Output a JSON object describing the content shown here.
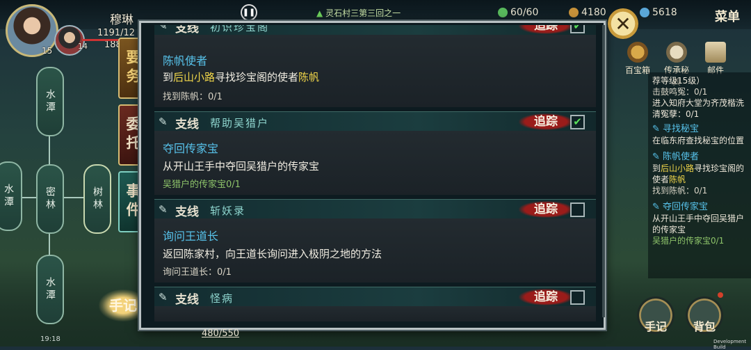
{
  "hud": {
    "player_name": "穆琳",
    "hp": "1191/12",
    "mp": "188",
    "level": "15",
    "pet_level": "14",
    "location": "灵石村三第三回之一",
    "energy": "60/60",
    "copper": "4180",
    "jade": "5618",
    "menu_label": "菜单",
    "time": "19:18",
    "bottom_value": "480/550",
    "dev_build": "Development Build"
  },
  "map_nodes": [
    "水潭",
    "密林",
    "水潭",
    "树林",
    "水潭"
  ],
  "side_tabs": [
    {
      "label": "要务"
    },
    {
      "label": "委托"
    },
    {
      "label": "事件"
    }
  ],
  "shouji_label": "手记",
  "quests": [
    {
      "type": "支线",
      "name": "初识珍宝阁",
      "checked": true,
      "title": "陈帆使者",
      "desc_pre": "到",
      "desc_hl1": "后山小路",
      "desc_mid": "寻找珍宝阁的使者",
      "desc_hl2": "陈帆",
      "progress": "找到陈帆：0/1"
    },
    {
      "type": "支线",
      "name": "帮助吴猎户",
      "checked": true,
      "title": "夺回传家宝",
      "desc": "从开山王手中夺回吴猎户的传家宝",
      "progress": "吴猎户的传家宝0/1"
    },
    {
      "type": "支线",
      "name": "斩妖录",
      "checked": false,
      "title": "询问王道长",
      "desc": "返回陈家村，向王道长询问进入极阴之地的方法",
      "progress": "询问王道长：0/1"
    },
    {
      "type": "支线",
      "name": "怪病",
      "checked": false
    }
  ],
  "track_label": "追踪",
  "top_icons": [
    {
      "label": "百宝箱"
    },
    {
      "label": "传承秘典"
    },
    {
      "label": "邮件"
    }
  ],
  "right_list": {
    "partial_1": "荐等级15级）",
    "partial_2": "击鼓鸣冤：0/1",
    "partial_3": "进入知府大堂为齐茂楷洗清冤孽：0/1",
    "items": [
      {
        "title": "寻找秘宝",
        "text": "在临东府查找秘宝的位置"
      },
      {
        "title": "陈帆使者",
        "text_pre": "到",
        "text_hl": "后山小路",
        "text_post": "寻找珍宝阁的使者",
        "text_hl2": "陈帆",
        "progress": "找到陈帆：0/1"
      },
      {
        "title": "夺回传家宝",
        "text": "从开山王手中夺回吴猎户的传家宝",
        "progress": "吴猎户的传家宝0/1"
      }
    ]
  },
  "bottom_icons": [
    {
      "label": "手记"
    },
    {
      "label": "背包"
    }
  ],
  "colors": {
    "quest_title": "#57c2ea",
    "highlight": "#f2d74a",
    "track_red": "#9a1c1a",
    "progress_green": "#8ec46a"
  }
}
